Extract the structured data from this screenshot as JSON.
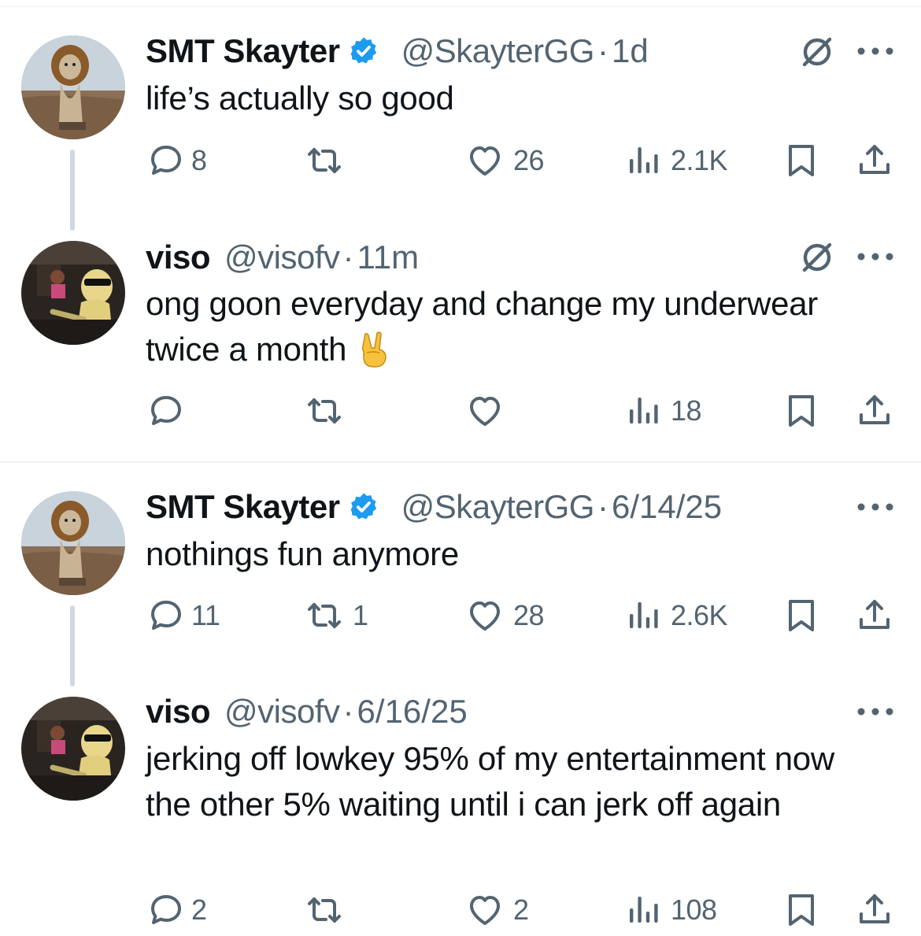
{
  "tweets": [
    {
      "name": "SMT Skayter",
      "verified": true,
      "handle": "@SkayterGG",
      "time": "1d",
      "text": "life’s actually so good",
      "replies": "8",
      "reposts": "",
      "likes": "26",
      "views": "2.1K",
      "grok_icon": true
    },
    {
      "name": "viso",
      "verified": false,
      "handle": "@visofv",
      "time": "11m",
      "text": "ong goon everyday and change my underwear twice a month",
      "emoji": "victory-hand",
      "replies": "",
      "reposts": "",
      "likes": "",
      "views": "18",
      "grok_icon": true
    },
    {
      "name": "SMT Skayter",
      "verified": true,
      "handle": "@SkayterGG",
      "time": "6/14/25",
      "text": "nothings fun anymore",
      "replies": "11",
      "reposts": "1",
      "likes": "28",
      "views": "2.6K",
      "grok_icon": false
    },
    {
      "name": "viso",
      "verified": false,
      "handle": "@visofv",
      "time": "6/16/25",
      "text": "jerking off lowkey 95% of my entertainment now the other 5% waiting until i can jerk off again",
      "replies": "2",
      "reposts": "",
      "likes": "2",
      "views": "108",
      "grok_icon": false
    }
  ],
  "separator": "·",
  "colors": {
    "text": "#0f1419",
    "secondary": "#536471",
    "verified": "#1d9bf0",
    "divider": "#eff3f4",
    "thread_line": "#cfd9de"
  },
  "icons": {
    "reply": "speech-bubble-icon",
    "repost": "repost-arrows-icon",
    "like": "heart-icon",
    "views": "bar-chart-icon",
    "bookmark": "bookmark-icon",
    "share": "share-upload-icon",
    "grok": "grok-icon",
    "more": "more-dots-icon",
    "verified": "verified-badge-icon"
  }
}
